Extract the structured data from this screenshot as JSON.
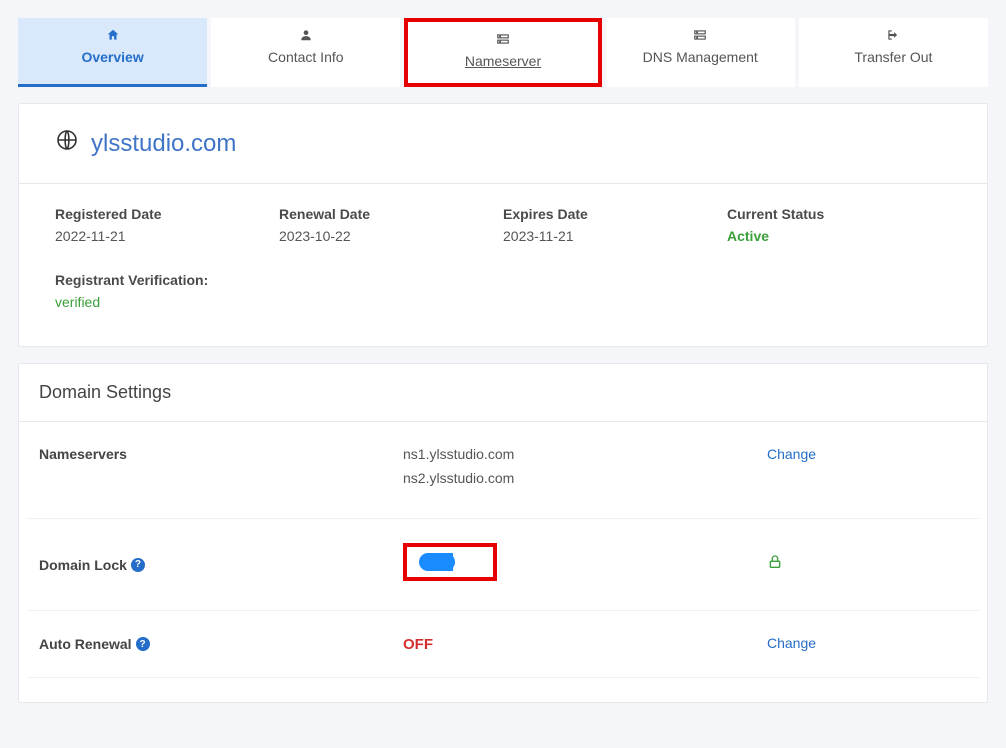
{
  "tabs": {
    "overview": "Overview",
    "contact": "Contact Info",
    "nameserver": "Nameserver",
    "dns": "DNS Management",
    "transfer": "Transfer Out"
  },
  "domain": "ylsstudio.com",
  "dates": {
    "registered_label": "Registered Date",
    "registered_value": "2022-11-21",
    "renewal_label": "Renewal Date",
    "renewal_value": "2023-10-22",
    "expires_label": "Expires Date",
    "expires_value": "2023-11-21",
    "status_label": "Current Status",
    "status_value": "Active"
  },
  "registrant": {
    "label": "Registrant Verification:",
    "value": "verified"
  },
  "settings": {
    "title": "Domain Settings",
    "nameservers_label": "Nameservers",
    "nameservers": {
      "ns1": "ns1.ylsstudio.com",
      "ns2": "ns2.ylsstudio.com"
    },
    "change": "Change",
    "domain_lock_label": "Domain Lock",
    "auto_renewal_label": "Auto Renewal",
    "auto_renewal_value": "OFF"
  }
}
